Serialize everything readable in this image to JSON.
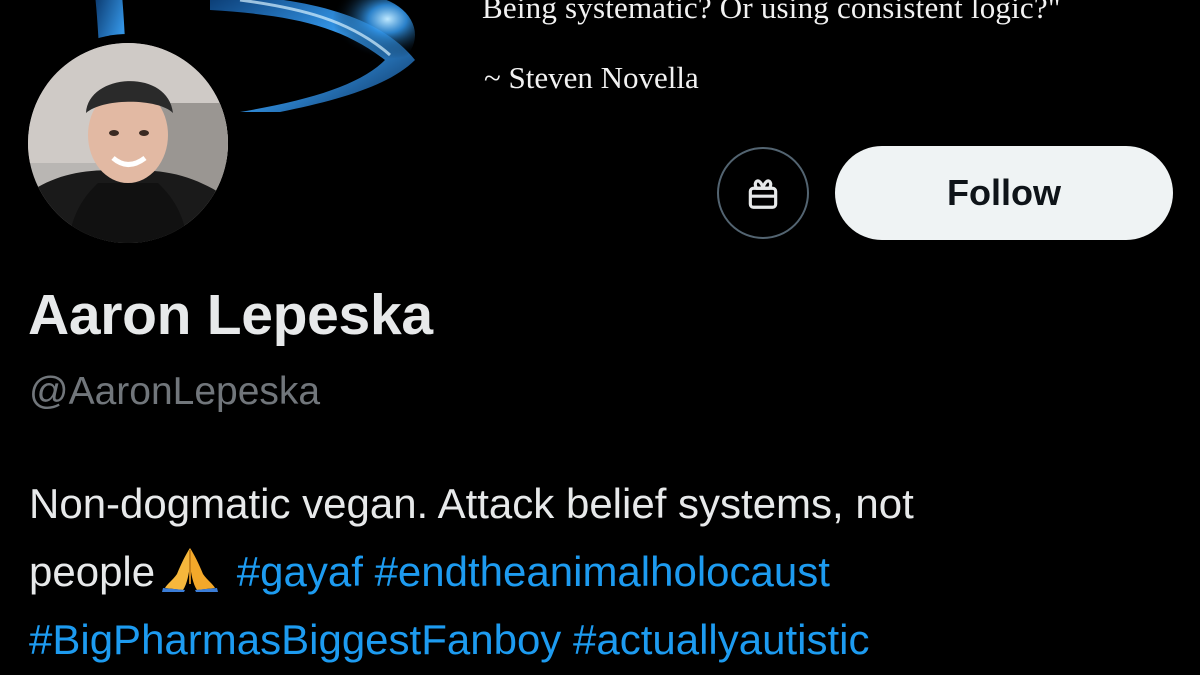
{
  "banner": {
    "quote_line": "Being systematic? Or using consistent logic?\"",
    "quote_author": "~ Steven Novella"
  },
  "profile": {
    "display_name": "Aaron Lepeska",
    "handle": "@AaronLepeska"
  },
  "actions": {
    "gift_icon": "gift-icon",
    "follow_label": "Follow"
  },
  "bio": {
    "line1": "Non-dogmatic vegan. Attack belief systems, not",
    "line2_text": "people",
    "emoji": "folded-hands-emoji",
    "hashtags": [
      "#gayaf",
      "#endtheanimalholocaust",
      "#BigPharmasBiggestFanboy",
      "#actuallyautistic"
    ]
  },
  "colors": {
    "background": "#000000",
    "text_primary": "#e7e9ea",
    "text_secondary": "#71767b",
    "link": "#1d9bf0",
    "follow_bg": "#eff3f4",
    "follow_text": "#0f1419",
    "border": "#536471"
  }
}
